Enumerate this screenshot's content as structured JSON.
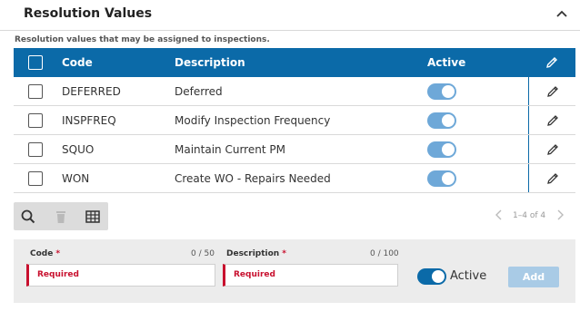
{
  "panel": {
    "title": "Resolution Values",
    "subtitle": "Resolution values that may be assigned to inspections."
  },
  "grid": {
    "columns": {
      "code": "Code",
      "description": "Description",
      "active": "Active"
    },
    "rows": [
      {
        "code": "DEFERRED",
        "description": "Deferred",
        "active": true
      },
      {
        "code": "INSPFREQ",
        "description": "Modify Inspection Frequency",
        "active": true
      },
      {
        "code": "SQUO",
        "description": "Maintain Current PM",
        "active": true
      },
      {
        "code": "WON",
        "description": "Create WO - Repairs Needed",
        "active": true
      }
    ]
  },
  "pager": {
    "text": "1–4 of 4"
  },
  "form": {
    "code_label": "Code",
    "code_count": "0 / 50",
    "code_placeholder": "Required",
    "description_label": "Description",
    "description_count": "0 / 100",
    "description_placeholder": "Required",
    "required_marker": "*",
    "active_label": "Active",
    "add_label": "Add"
  },
  "colors": {
    "header_bg": "#0b6aa8",
    "toggle_on": "#6ea8d8",
    "required": "#c8102e",
    "add_button_disabled": "#a9cbe6"
  },
  "icons": {
    "collapse": "chevron-up-icon",
    "edit": "pencil-icon",
    "search": "search-icon",
    "delete": "trash-icon",
    "columns": "table-icon",
    "prev": "chevron-left-icon",
    "next": "chevron-right-icon"
  }
}
